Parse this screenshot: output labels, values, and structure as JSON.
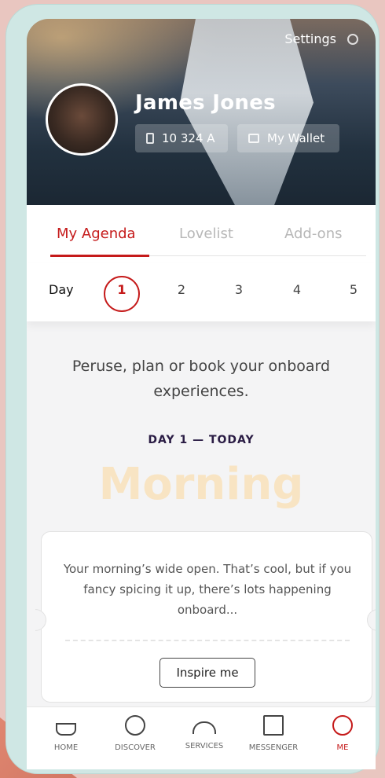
{
  "header": {
    "settings_label": "Settings",
    "user_name": "James Jones",
    "cabin": "10 324 A",
    "wallet_label": "My Wallet"
  },
  "tabs": [
    {
      "label": "My Agenda",
      "active": true
    },
    {
      "label": "Lovelist",
      "active": false
    },
    {
      "label": "Add-ons",
      "active": false
    }
  ],
  "days": {
    "label": "Day",
    "items": [
      "1",
      "2",
      "3",
      "4",
      "5"
    ],
    "selected": "1"
  },
  "content": {
    "intro": "Peruse, plan or book your onboard experiences.",
    "day_tag": "DAY 1 — TODAY",
    "period": "Morning",
    "card_text": "Your morning’s wide open. That’s cool, but if you fancy spicing it up, there’s lots happening onboard...",
    "cta_label": "Inspire me"
  },
  "nav": [
    {
      "label": "HOME",
      "icon": "ship-icon"
    },
    {
      "label": "DISCOVER",
      "icon": "compass-icon"
    },
    {
      "label": "SERVICES",
      "icon": "bell-icon"
    },
    {
      "label": "MESSENGER",
      "icon": "message-icon"
    },
    {
      "label": "ME",
      "icon": "profile-icon",
      "active": true
    }
  ],
  "colors": {
    "accent": "#c51a1a",
    "period_text": "#f8e4c3",
    "day_tag": "#2a1c44"
  }
}
